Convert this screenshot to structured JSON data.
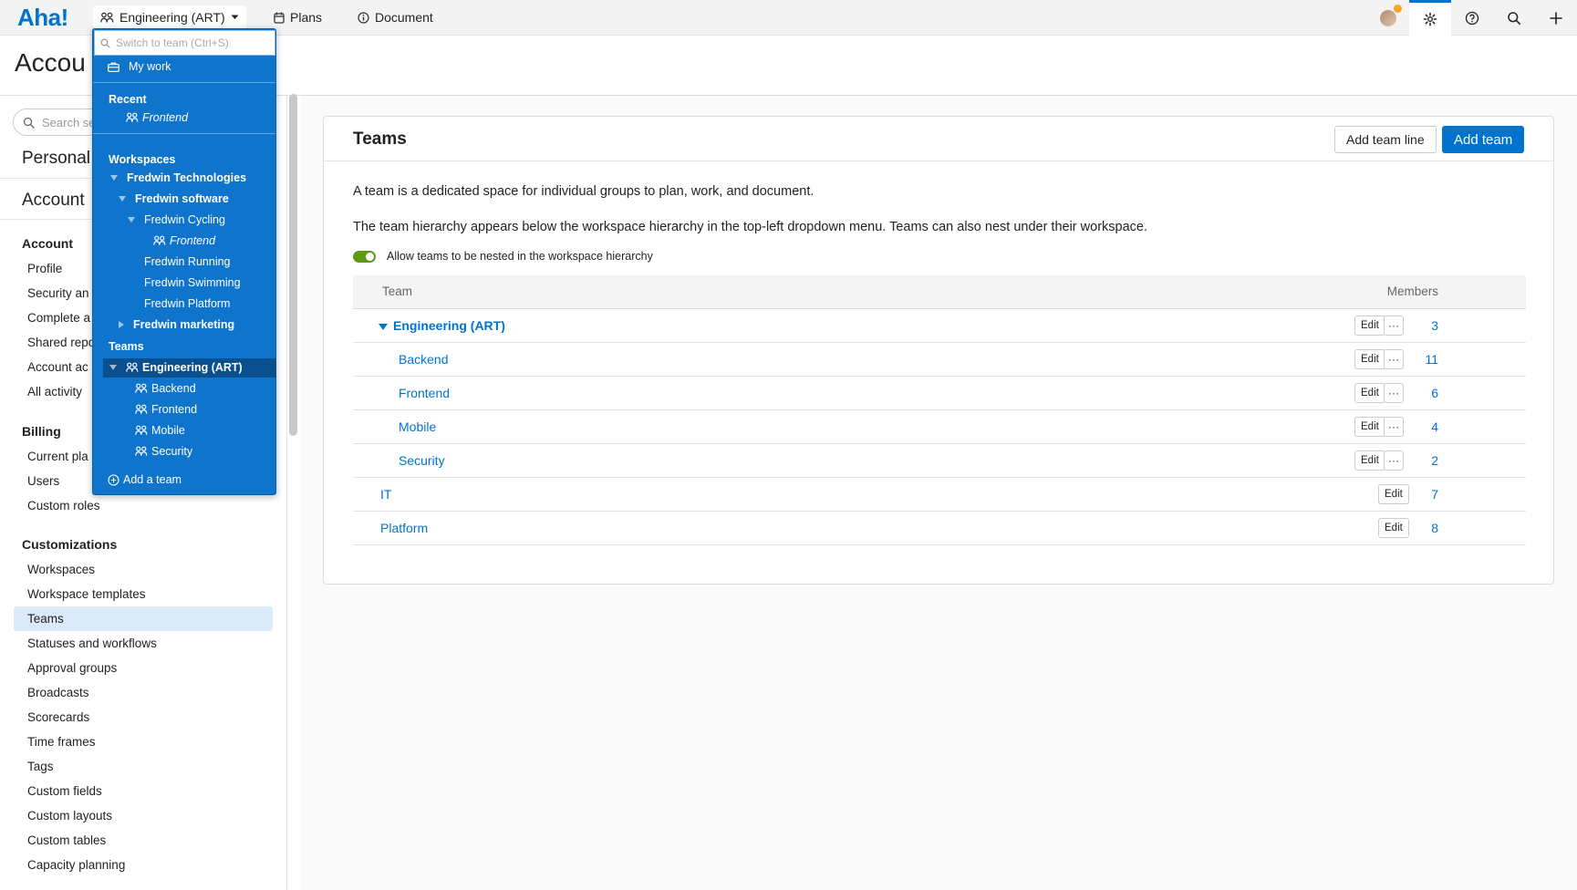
{
  "app": {
    "logo": "Aha!"
  },
  "topnav": {
    "team_label": "Engineering (ART)",
    "plans_label": "Plans",
    "document_label": "Document"
  },
  "page": {
    "title": "Accou"
  },
  "sidebar": {
    "search_placeholder": "Search se",
    "personal": "Personal",
    "account_heading": "Account",
    "account_section": "Account",
    "account_items": [
      "Profile",
      "Security an",
      "Complete a",
      "Shared repo",
      "Account ac",
      "All activity"
    ],
    "billing_section": "Billing",
    "billing_items": [
      "Current pla",
      "Users",
      "Custom roles"
    ],
    "customizations_section": "Customizations",
    "customization_items": [
      "Workspaces",
      "Workspace templates",
      "Teams",
      "Statuses and workflows",
      "Approval groups",
      "Broadcasts",
      "Scorecards",
      "Time frames",
      "Tags",
      "Custom fields",
      "Custom layouts",
      "Custom tables",
      "Capacity planning"
    ]
  },
  "main": {
    "title": "Teams",
    "add_team_line": "Add team line",
    "add_team": "Add team",
    "desc1": "A team is a dedicated space for individual groups to plan, work, and document.",
    "desc2": "The team hierarchy appears below the workspace hierarchy in the top-left dropdown menu. Teams can also nest under their workspace.",
    "toggle_label": "Allow teams to be nested in the workspace hierarchy",
    "toggle_on": true,
    "table": {
      "col_team": "Team",
      "col_members": "Members",
      "edit_label": "Edit",
      "more_label": "···",
      "rows": [
        {
          "name": "Engineering (ART)",
          "members": "3"
        },
        {
          "name": "Backend",
          "members": "11"
        },
        {
          "name": "Frontend",
          "members": "6"
        },
        {
          "name": "Mobile",
          "members": "4"
        },
        {
          "name": "Security",
          "members": "2"
        },
        {
          "name": "IT",
          "members": "7"
        },
        {
          "name": "Platform",
          "members": "8"
        }
      ]
    }
  },
  "dropdown": {
    "search_placeholder": "Switch to team (Ctrl+S)",
    "my_work": "My work",
    "recent_heading": "Recent",
    "recent_items": [
      "Frontend"
    ],
    "workspaces_heading": "Workspaces",
    "workspaces": [
      "Fredwin Technologies",
      "Fredwin software",
      "Fredwin Cycling",
      "Frontend",
      "Fredwin Running",
      "Fredwin Swimming",
      "Fredwin Platform",
      "Fredwin marketing"
    ],
    "teams_heading": "Teams",
    "teams": [
      "Engineering (ART)",
      "Backend",
      "Frontend",
      "Mobile",
      "Security"
    ],
    "add_team": "Add a team"
  },
  "colors": {
    "accent": "#0073cf",
    "dropdown_bg": "#0f74cc",
    "selected_bg": "#0a4f8e",
    "toggle_on": "#5c9a16"
  }
}
